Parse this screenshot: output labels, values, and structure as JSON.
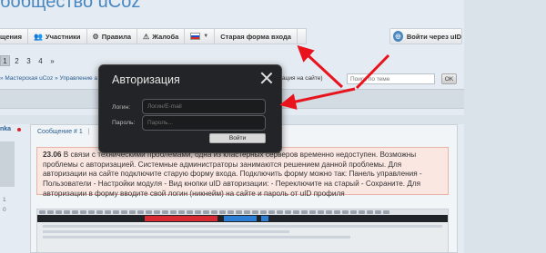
{
  "site": {
    "title": "бобщество uCoz"
  },
  "topnav": {
    "items": [
      {
        "label": "щения",
        "icon": ""
      },
      {
        "label": "Участники",
        "icon": "users-icon"
      },
      {
        "label": "Правила",
        "icon": "gear-icon"
      },
      {
        "label": "Жалоба",
        "icon": "warning-icon"
      }
    ],
    "language_flag": "russian-flag-icon",
    "old_login": "Старая форма входа",
    "uid_login": "Войти через uID"
  },
  "pager": {
    "pages": [
      "1",
      "2",
      "3",
      "4"
    ],
    "next": "»",
    "active": "1"
  },
  "breadcrumb": {
    "left": "» Мастерская uCoz » Управление а",
    "right": "ация на сайте)"
  },
  "search": {
    "placeholder": "Поиск по теме",
    "button": "OK"
  },
  "post": {
    "author": "nka",
    "header_left": "Сообщение # 1",
    "header_right": "1",
    "stats_1": "1",
    "stats_2": "0",
    "notice": {
      "bold": "23.06",
      "text": " В связи с техническими проблемами, одна из кластерных серверов временно недоступен. Возможны проблемы с авторизацией. Системные администраторы занимаются решением данной проблемы. Для авторизации на сайте подключите старую форму входа. Подключить форму можно так: Панель управления - Пользователи - Настройки модуля - Вид кнопки uID авторизации: - Переключите на старый - Сохраните. Для авторизации в форму вводите свой логин (никнейм) на сайте и пароль от uID профиля"
    }
  },
  "dialog": {
    "title": "Авторизация",
    "login_label": "Логин:",
    "login_placeholder": "Логин/E-mail",
    "password_label": "Пароль:",
    "password_placeholder": "Пароль...",
    "submit": "Войти"
  },
  "colors": {
    "arrow": "#e8131c",
    "accent": "#4a87c0",
    "dialog_bg": "#232427"
  }
}
